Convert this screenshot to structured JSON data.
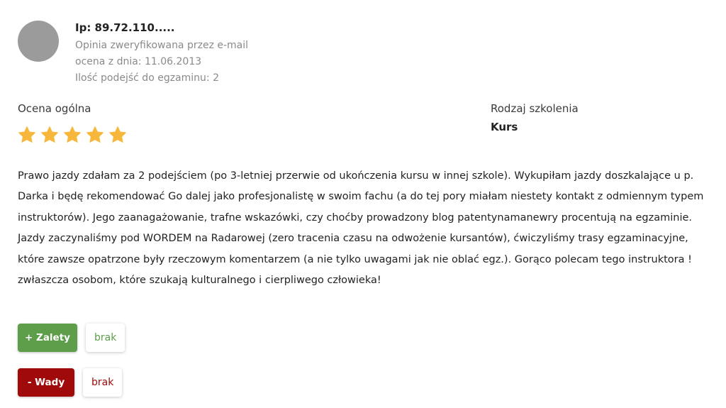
{
  "reviewer": {
    "ip": "Ip: 89.72.110.....",
    "verified": "Opinia zweryfikowana przez e-mail",
    "date": "ocena z dnia: 11.06.2013",
    "attempts": "Ilość podejść do egzaminu: 2"
  },
  "rating": {
    "label": "Ocena ogólna",
    "stars": 5,
    "max_stars": 5,
    "star_color": "#f6b73c"
  },
  "training": {
    "label": "Rodzaj szkolenia",
    "value": "Kurs"
  },
  "review": {
    "text": "Prawo jazdy zdałam za 2 podejściem (po 3-letniej przerwie od ukończenia kursu w innej szkole). Wykupiłam jazdy doszkalające u p. Darka i będę rekomendować Go dalej jako profesjonalistę w swoim fachu (a do tej pory miałam niestety kontakt z odmiennym typem instruktorów). Jego zaanagażowanie, trafne wskazówki, czy choćby prowadzony blog patentynamanewry procentują na egzaminie. Jazdy zaczynaliśmy pod WORDEM na Radarowej (zero tracenia czasu na odwożenie kursantów), ćwiczyliśmy trasy egzaminacyjne, które zawsze opatrzone były rzeczowym komentarzem (a nie tylko uwagami jak nie oblać egz.). Gorąco polecam tego instruktora ! zwłaszcza osobom, które szukają kulturalnego i cierpliwego człowieka!"
  },
  "pros": {
    "label": "+ Zalety",
    "value": "brak",
    "color": "#5e9e4b"
  },
  "cons": {
    "label": "- Wady",
    "value": "brak",
    "color": "#a10a0a"
  }
}
